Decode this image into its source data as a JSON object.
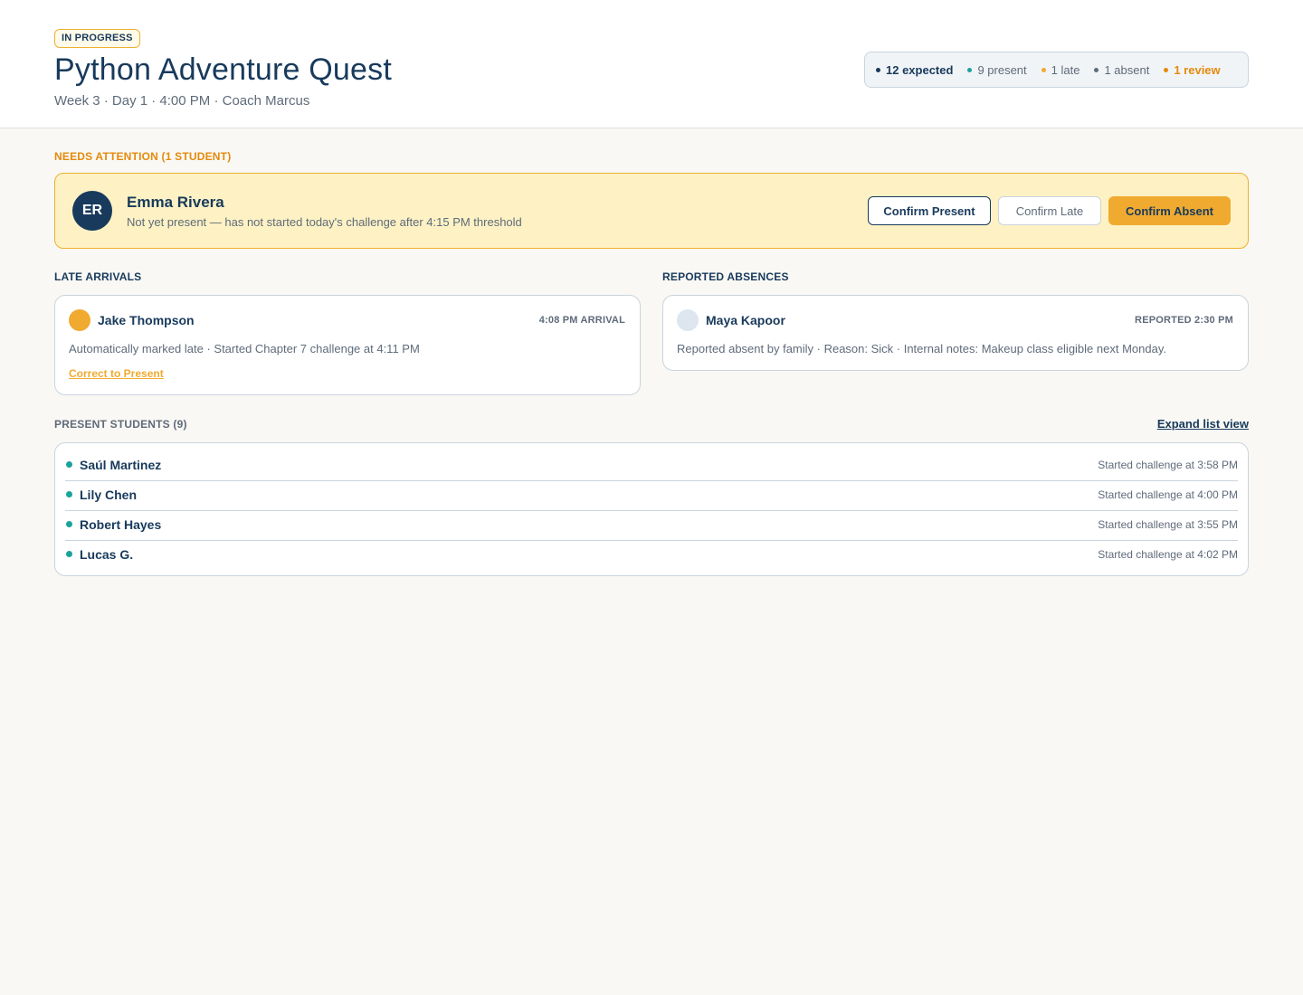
{
  "header": {
    "status": "IN PROGRESS",
    "title": "Python Adventure Quest",
    "subtitle": "Week 3 · Day 1 · 4:00 PM · Coach Marcus"
  },
  "summary": {
    "expected": "12 expected",
    "present": "9 present",
    "late": "1 late",
    "absent": "1 absent",
    "review": "1 review"
  },
  "colors": {
    "navy": "#183a5c",
    "teal": "#1aa39a",
    "amber": "#f0aa30",
    "orange": "#e48a0c",
    "slate": "#5f6b7a"
  },
  "attention": {
    "label": "NEEDS ATTENTION (1 STUDENT)",
    "initials": "ER",
    "name": "Emma Rivera",
    "description": "Not yet present — has not started today's challenge after 4:15 PM threshold",
    "buttons": {
      "present": "Confirm Present",
      "late": "Confirm Late",
      "absent": "Confirm Absent"
    }
  },
  "late": {
    "label": "LATE ARRIVALS",
    "name": "Jake Thompson",
    "meta": "4:08 PM ARRIVAL",
    "description": "Automatically marked late · Started Chapter 7 challenge at 4:11 PM",
    "action": "Correct to Present"
  },
  "absences": {
    "label": "REPORTED ABSENCES",
    "name": "Maya Kapoor",
    "meta": "REPORTED 2:30 PM",
    "description": "Reported absent by family · Reason: Sick · Internal notes: Makeup class eligible next Monday."
  },
  "present": {
    "label": "PRESENT STUDENTS (9)",
    "expand": "Expand list view",
    "students": [
      {
        "name": "Saúl Martinez",
        "time": "Started challenge at 3:58 PM"
      },
      {
        "name": "Lily Chen",
        "time": "Started challenge at 4:00 PM"
      },
      {
        "name": "Robert Hayes",
        "time": "Started challenge at 3:55 PM"
      },
      {
        "name": "Lucas G.",
        "time": "Started challenge at 4:02 PM"
      }
    ]
  }
}
